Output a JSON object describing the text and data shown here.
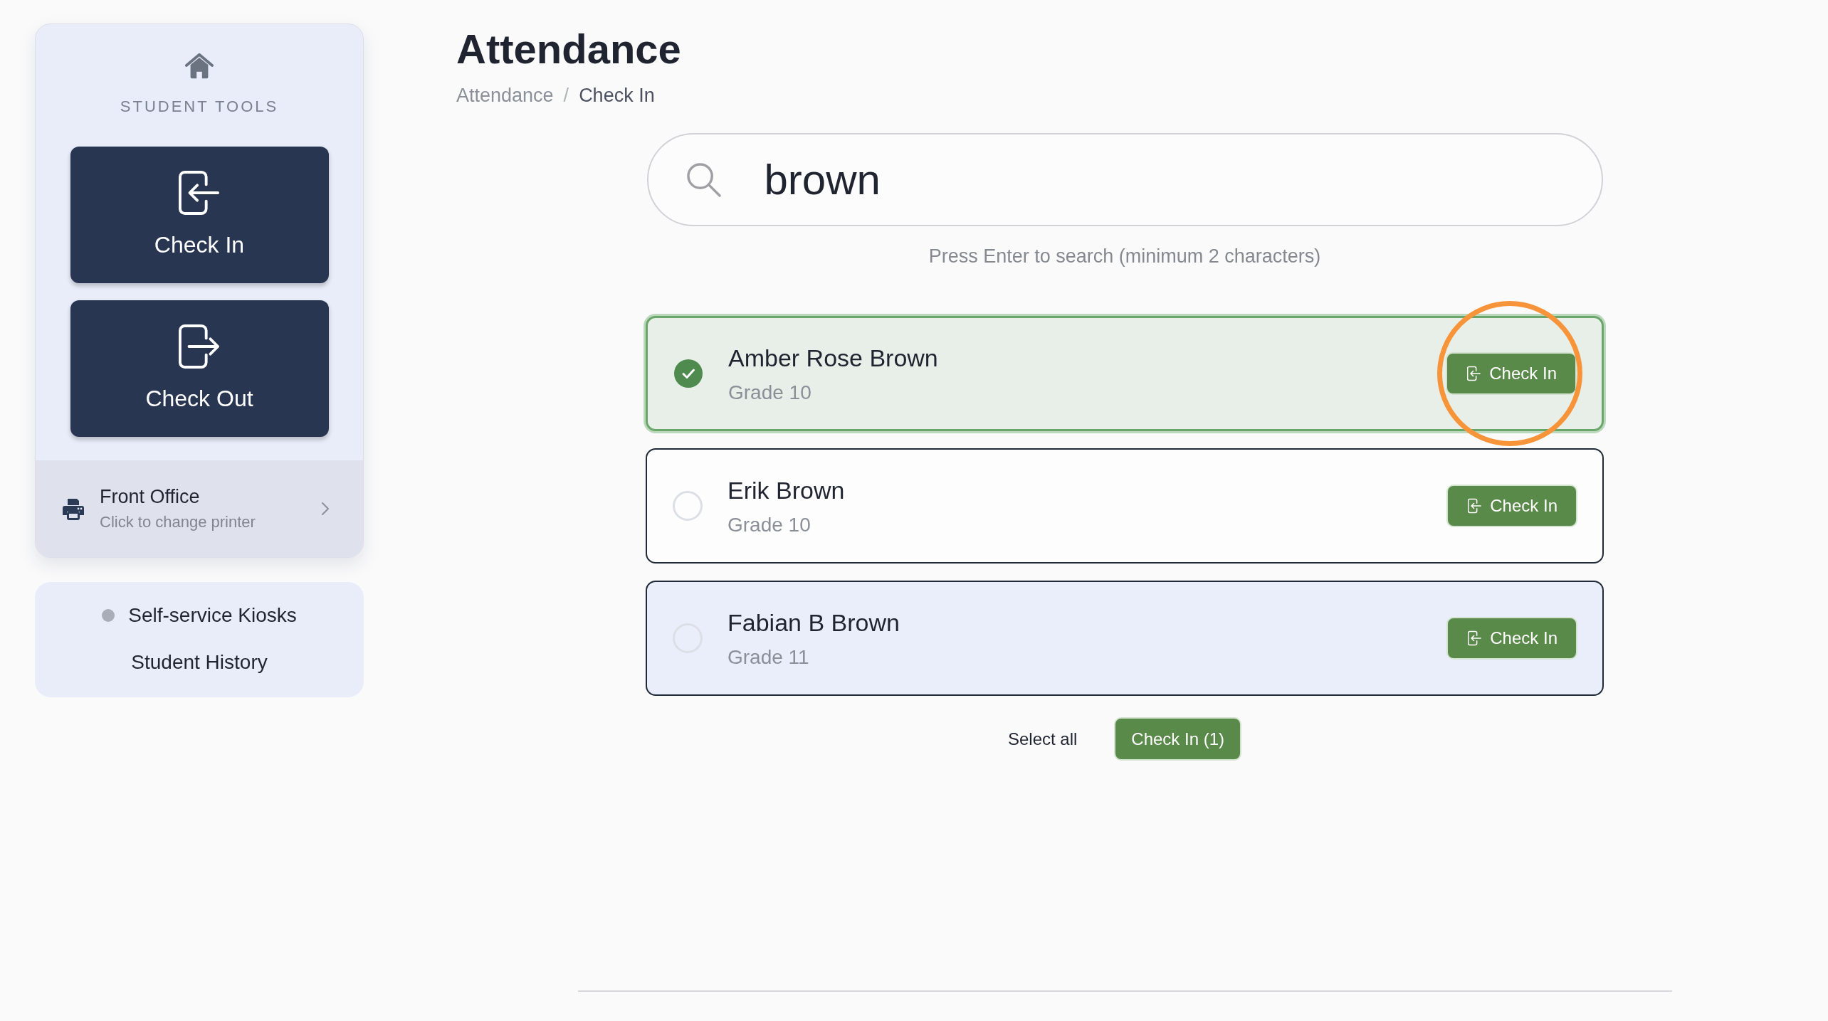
{
  "sidebar": {
    "heading": "STUDENT TOOLS",
    "actions": [
      {
        "kind": "check_in",
        "label": "Check In"
      },
      {
        "kind": "check_out",
        "label": "Check Out"
      }
    ],
    "printer": {
      "name": "Front Office",
      "hint": "Click to change printer"
    },
    "links": [
      {
        "kind": "status",
        "label": "Self-service Kiosks"
      },
      {
        "kind": "plain",
        "label": "Student History"
      }
    ]
  },
  "header": {
    "title": "Attendance",
    "separator": "/",
    "breadcrumb": [
      {
        "label": "Attendance",
        "current": false
      },
      {
        "label": "Check In",
        "current": true
      }
    ]
  },
  "search": {
    "value": "brown",
    "hint": "Press Enter to search (minimum 2 characters)"
  },
  "students": [
    {
      "name": "Amber Rose Brown",
      "grade": "Grade 10",
      "selected": true,
      "hovered": false,
      "circled": true,
      "action": "Check In"
    },
    {
      "name": "Erik Brown",
      "grade": "Grade 10",
      "selected": false,
      "hovered": false,
      "circled": false,
      "action": "Check In"
    },
    {
      "name": "Fabian B Brown",
      "grade": "Grade 11",
      "selected": false,
      "hovered": true,
      "circled": false,
      "action": "Check In"
    }
  ],
  "bulk_actions": {
    "select_all": "Select all",
    "submit": "Check In (1)"
  }
}
